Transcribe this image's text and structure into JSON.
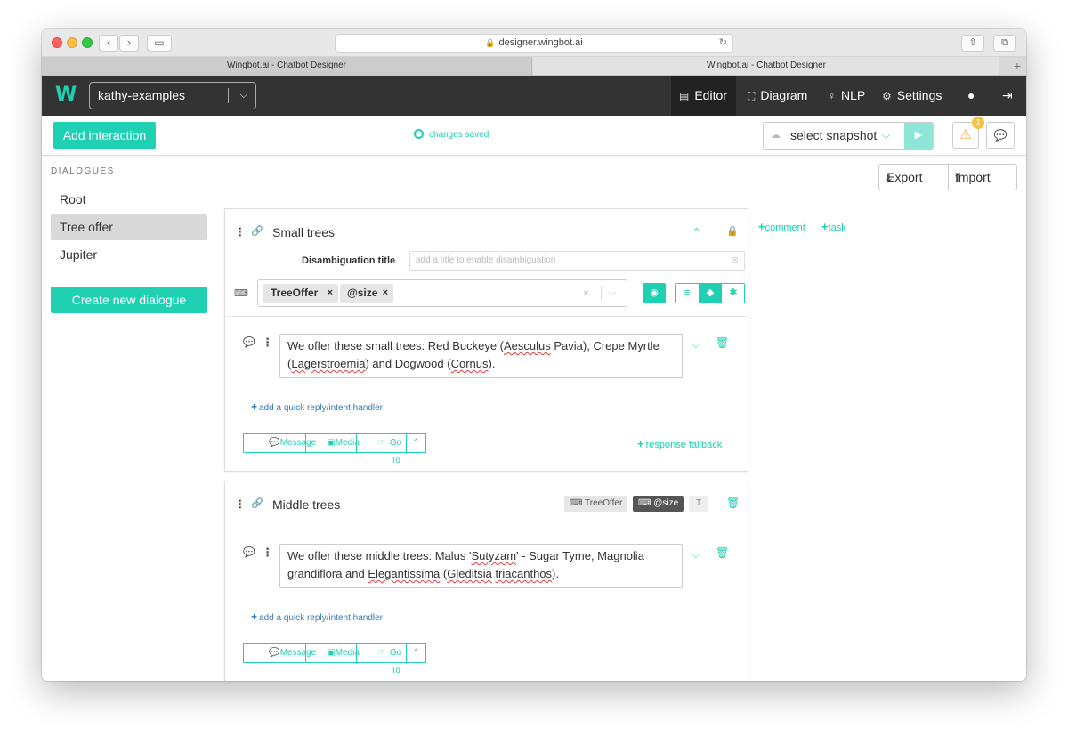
{
  "browser": {
    "url": "designer.wingbot.ai",
    "tabs": [
      "Wingbot.ai - Chatbot Designer",
      "Wingbot.ai - Chatbot Designer"
    ]
  },
  "app": {
    "logo": "W",
    "bot_name": "kathy-examples",
    "nav": [
      {
        "label": "Editor",
        "icon": "editor-icon"
      },
      {
        "label": "Diagram",
        "icon": "diagram-icon"
      },
      {
        "label": "NLP",
        "icon": "bulb-icon"
      },
      {
        "label": "Settings",
        "icon": "gears-icon"
      }
    ]
  },
  "toolbar": {
    "add_interaction": "Add interaction",
    "status": "changes saved",
    "snapshot": "select snapshot",
    "warning_count": "1"
  },
  "sidebar": {
    "title": "DIALOGUES",
    "items": [
      "Root",
      "Tree offer",
      "Jupiter"
    ],
    "active_index": 1,
    "create_button": "Create new dialogue"
  },
  "actions": {
    "export": "Export",
    "import": "Import",
    "comment": "comment",
    "task": "task"
  },
  "interactions": [
    {
      "title": "Small trees",
      "disambiguation_label": "Disambiguation title",
      "disambiguation_placeholder": "add a title to enable disambiguation",
      "intents": [
        "TreeOffer",
        "@size"
      ],
      "message": "We offer these small trees: Red Buckeye (Aesculus Pavia), Crepe Myrtle (Lagerstroemia) and Dogwood (Cornus).",
      "quick_reply": "add a quick reply/intent handler",
      "response_types": [
        "Message",
        "Media",
        "Go To"
      ],
      "fallback": "response fallback"
    },
    {
      "title": "Middle trees",
      "tags": [
        "TreeOffer",
        "@size"
      ],
      "message": "We offer these middle trees: Malus 'Sutyzam' - Sugar Tyme, Magnolia grandiflora and Elegantissima (Gleditsia triacanthos).",
      "quick_reply": "add a quick reply/intent handler",
      "response_types": [
        "Message",
        "Media",
        "Go To"
      ]
    }
  ],
  "colors": {
    "accent": "#1fd1b2",
    "nav_bg": "#333333",
    "warning": "#f5c243",
    "link": "#337ab7"
  }
}
